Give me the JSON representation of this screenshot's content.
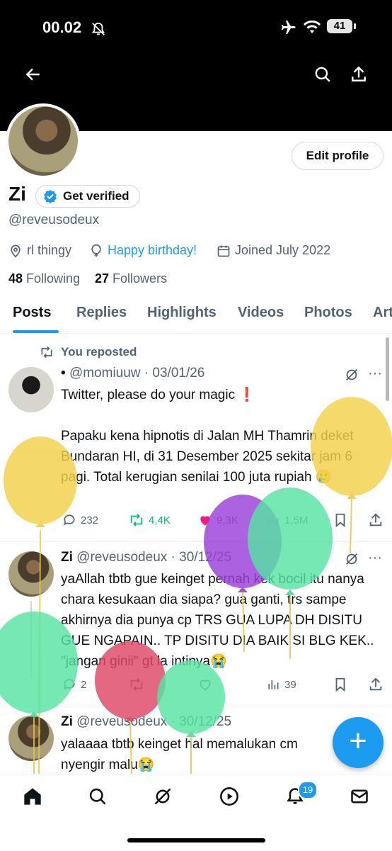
{
  "status_bar": {
    "time": "00.02",
    "battery": "41"
  },
  "profile": {
    "edit_label": "Edit profile",
    "name": "Zi",
    "verify_label": "Get verified",
    "handle": "@reveusodeux",
    "location": "rl thingy",
    "birthday": "Happy birthday!",
    "joined": "Joined July 2022",
    "following_count": "48",
    "following_label": "Following",
    "followers_count": "27",
    "followers_label": "Followers"
  },
  "tabs": [
    "Posts",
    "Replies",
    "Highlights",
    "Videos",
    "Photos",
    "Art"
  ],
  "tweets": [
    {
      "context": "You reposted",
      "dot": "•",
      "name": "",
      "handle": "@momiuuw",
      "date": "· 03/01/26",
      "text": "Twitter, please do your magic ❗\n\nPapaku kena hipnotis di Jalan MH Thamrin deket Bundaran HI, di 31 Desember 2025 sekitar jam 6 pagi. Total kerugian senilai 100 juta rupiah 🥲",
      "replies": "232",
      "reposts": "4,4K",
      "likes": "9,3K",
      "views": "1,5M"
    },
    {
      "name": "Zi",
      "handle": "@reveusodeux",
      "date": "· 30/12/25",
      "text": "yaAllah tbtb gue keinget pernah kek bocil itu nanya chara kesukaan dia siapa? gua ganti, trs sampe akhirnya dia punya cp TRS GUA LUPA DH DISITU GUE NGAPAIN.. TP DISITU DIA BAIK SI BLG KEK.. \"jangan ginii\" gt la intinya😭",
      "replies": "2",
      "views": "39"
    },
    {
      "name": "Zi",
      "handle": "@reveusodeux",
      "date": "· 30/12/25",
      "text": "yalaaaa tbtb keinget hal memalukan cm nyengir malu😭"
    }
  ],
  "notifications_badge": "19",
  "colors": {
    "accent": "#1d9bf0",
    "repost": "#00ba7c",
    "like": "#f91880"
  }
}
